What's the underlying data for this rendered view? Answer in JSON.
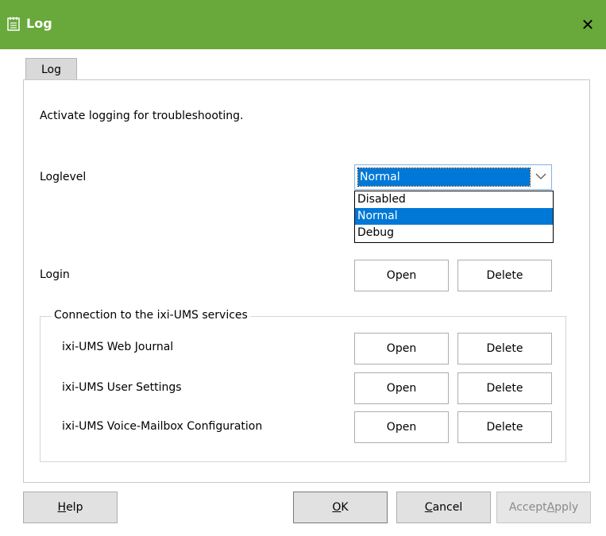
{
  "window": {
    "title": "Log",
    "close_glyph": "✕",
    "icon": "notepad-icon",
    "accent": "#69a83a"
  },
  "tabs": [
    {
      "label": "Log",
      "active": true
    }
  ],
  "intro_text": "Activate logging for troubleshooting.",
  "loglevel": {
    "label": "Loglevel",
    "selected": "Normal",
    "options": [
      "Disabled",
      "Normal",
      "Debug"
    ]
  },
  "login": {
    "label": "Login",
    "open_label": "Open",
    "delete_label": "Delete"
  },
  "services": {
    "group_label": "Connection to the ixi-UMS services",
    "items": [
      {
        "label": "ixi-UMS Web Journal",
        "open_label": "Open",
        "delete_label": "Delete"
      },
      {
        "label": "ixi-UMS User Settings",
        "open_label": "Open",
        "delete_label": "Delete"
      },
      {
        "label": "ixi-UMS Voice-Mailbox Configuration",
        "open_label": "Open",
        "delete_label": "Delete"
      }
    ]
  },
  "footer": {
    "help": {
      "mnemonic": "H",
      "rest": "elp"
    },
    "ok": {
      "mnemonic": "O",
      "rest": "K"
    },
    "cancel": {
      "mnemonic": "C",
      "rest": "ancel"
    },
    "accept": {
      "pre": "Accept",
      "mnemonic": "A",
      "rest": "pply",
      "disabled": true
    }
  }
}
